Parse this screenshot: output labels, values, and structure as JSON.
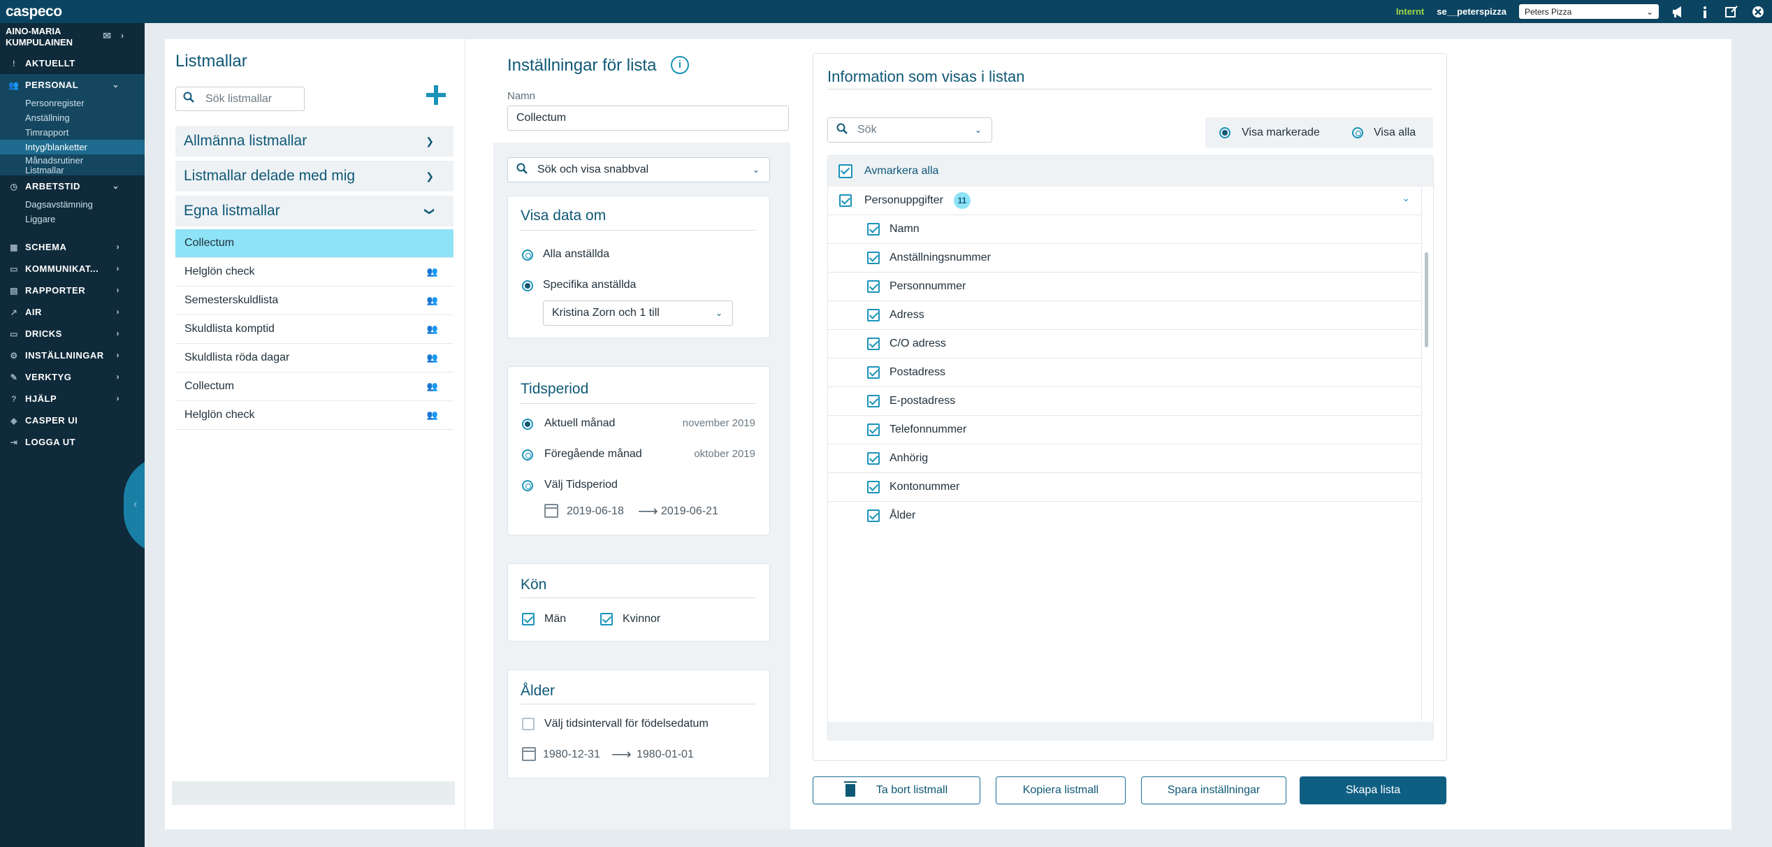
{
  "topbar": {
    "logo": "caspeco",
    "env_label": "Internt",
    "user_id": "se__peterspizza",
    "company_selected": "Peters Pizza",
    "icons": [
      "megaphone-icon",
      "info-icon",
      "edit-icon",
      "close-icon"
    ]
  },
  "sidebar": {
    "user_line1": "AINO-MARIA",
    "user_line2": "KUMPULAINEN",
    "aktuellt": "AKTUELLT",
    "personal": "PERSONAL",
    "personal_items": [
      "Personregister",
      "Anställning",
      "Timrapport",
      "Intyg/blanketter",
      "Månadsrutiner",
      "Listmallar"
    ],
    "arbetstid": "ARBETSTID",
    "arbetstid_items": [
      "Dagsavstämning",
      "Liggare"
    ],
    "items": [
      "SCHEMA",
      "KOMMUNIKAT...",
      "RAPPORTER",
      "AIR",
      "DRICKS",
      "INSTÄLLNINGAR",
      "VERKTYG",
      "HJÄLP",
      "CASPER UI",
      "LOGGA UT"
    ]
  },
  "listmallar": {
    "title": "Listmallar",
    "search_placeholder": "Sök listmallar",
    "categories": [
      "Allmänna listmallar",
      "Listmallar delade med mig",
      "Egna listmallar"
    ],
    "rows": [
      "Collectum",
      "Helglön check",
      "Semesterskuldlista",
      "Skuldlista komptid",
      "Skuldlista röda dagar",
      "Collectum",
      "Helglön check"
    ]
  },
  "settings": {
    "title": "Inställningar för lista",
    "name_label": "Namn",
    "name_value": "Collectum",
    "quick_search": "Sök och visa snabbval",
    "visa_title": "Visa data om",
    "visa_all": "Alla anställda",
    "visa_specific": "Specifika anställda",
    "employees_selected": "Kristina Zorn och 1 till",
    "tid_title": "Tidsperiod",
    "tid_current": "Aktuell månad",
    "tid_current_value": "november 2019",
    "tid_prev": "Föregående månad",
    "tid_prev_value": "oktober 2019",
    "tid_custom": "Välj Tidsperiod",
    "tid_from": "2019-06-18",
    "tid_to": "2019-06-21",
    "kon_title": "Kön",
    "kon_man": "Män",
    "kon_kvinnor": "Kvinnor",
    "alder_title": "Ålder",
    "alder_check": "Välj tidsintervall för födelsedatum",
    "alder_from": "1980-12-31",
    "alder_to": "1980-01-01"
  },
  "info": {
    "title": "Information som visas i listan",
    "search_placeholder": "Sök",
    "toggle_marked": "Visa markerade",
    "toggle_all": "Visa alla",
    "deselect_all": "Avmarkera alla",
    "group_name": "Personuppgifter",
    "group_count": "11",
    "fields": [
      "Namn",
      "Anställningsnummer",
      "Personnummer",
      "Adress",
      "C/O adress",
      "Postadress",
      "E-postadress",
      "Telefonnummer",
      "Anhörig",
      "Kontonummer",
      "Ålder"
    ]
  },
  "buttons": {
    "delete": "Ta bort listmall",
    "copy": "Kopiera listmall",
    "save": "Spara inställningar",
    "create": "Skapa lista"
  },
  "colors": {
    "topbar": "#0b4460",
    "sidebar": "#0f2a3a",
    "accent": "#1a93b8",
    "selected_row": "#8ee3f6",
    "primary_button": "#0f5f83",
    "env_label": "#9ed64a"
  }
}
